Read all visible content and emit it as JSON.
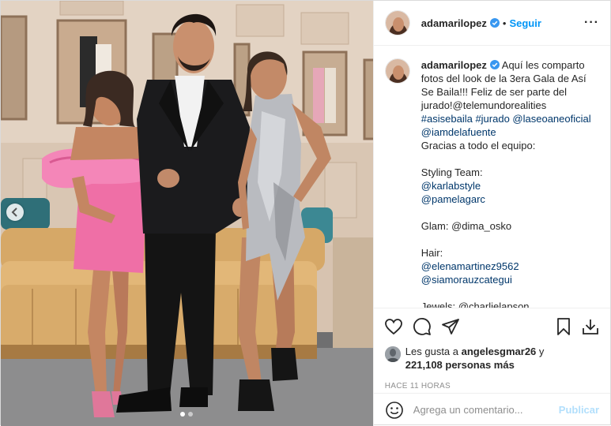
{
  "post": {
    "username": "adamarilopez",
    "follow_label": "Seguir",
    "separator": "•",
    "more_icon": "more-options-icon",
    "caption_lines": [
      {
        "text": "Aquí les comparto",
        "type": "text"
      },
      {
        "text": "fotos del look de la 3era Gala de Así",
        "type": "text"
      },
      {
        "text": "Se Baila!!! Feliz de ser parte del",
        "type": "text"
      },
      {
        "text": "jurado!@telemundorealities",
        "type": "text"
      },
      {
        "text": "#asisebaila #jurado @laseoaneoficial",
        "type": "link"
      },
      {
        "text": "@iamdelafuente",
        "type": "link"
      },
      {
        "text": "Gracias a todo el equipo:",
        "type": "text"
      },
      {
        "text": "",
        "type": "blank"
      },
      {
        "text": "Styling Team:",
        "type": "text"
      },
      {
        "text": "@karlabstyle",
        "type": "link"
      },
      {
        "text": "@pamelagarc",
        "type": "link"
      },
      {
        "text": "",
        "type": "blank"
      },
      {
        "text": "Glam: @dima_osko",
        "type": "text"
      },
      {
        "text": "",
        "type": "blank"
      },
      {
        "text": "Hair:",
        "type": "text"
      },
      {
        "text": "@elenamartinez9562",
        "type": "link"
      },
      {
        "text": "@siamorauzcategui",
        "type": "link"
      },
      {
        "text": "",
        "type": "blank"
      },
      {
        "text": "Jewels: @charlielapson",
        "type": "text"
      }
    ],
    "likes": {
      "prefix": "Les gusta a",
      "user": "angelesgmar26",
      "connector": "y",
      "count": "221,108 personas más"
    },
    "time": "HACE 11 HORAS",
    "comment": {
      "placeholder": "Agrega un comentario...",
      "publish_label": "Publicar"
    },
    "carousel": {
      "total": 2,
      "active": 1
    },
    "colors": {
      "link": "#00376b",
      "follow": "#0095f6",
      "publish": "#b2dffc",
      "muted": "#8e8e8e"
    }
  }
}
